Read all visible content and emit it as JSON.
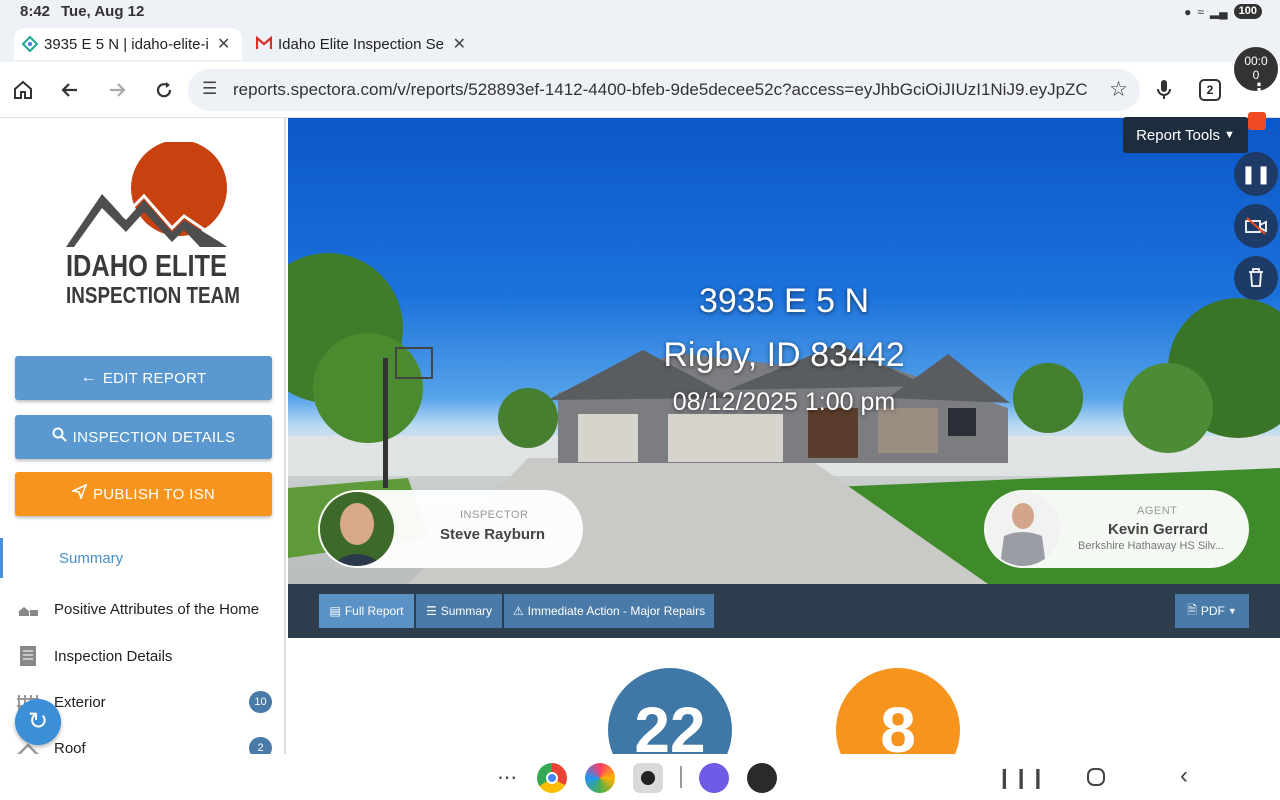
{
  "status_bar": {
    "time": "8:42",
    "date": "Tue, Aug 12",
    "battery": "100"
  },
  "tabs": [
    {
      "title": "3935 E 5 N | idaho-elite-i",
      "active": true
    },
    {
      "title": "Idaho Elite Inspection Se",
      "active": false
    }
  ],
  "toolbar": {
    "url": "reports.spectora.com/v/reports/528893ef-1412-4400-bfeb-9de5decee52c?access=eyJhbGciOiJIUzI1NiJ9.eyJpZC",
    "tab_count": "2"
  },
  "sidebar": {
    "logo_line1": "IDAHO ELITE",
    "logo_line2": "INSPECTION TEAM",
    "buttons": {
      "edit": "EDIT REPORT",
      "details": "INSPECTION DETAILS",
      "publish": "PUBLISH TO ISN"
    },
    "nav": [
      {
        "label": "Summary",
        "badge": ""
      },
      {
        "label": "Positive Attributes of the Home",
        "badge": ""
      },
      {
        "label": "Inspection Details",
        "badge": ""
      },
      {
        "label": "Exterior",
        "badge": "10"
      },
      {
        "label": "Roof",
        "badge": "2"
      }
    ]
  },
  "hero": {
    "address_line1": "3935 E 5 N",
    "address_line2": "Rigby, ID 83442",
    "datetime": "08/12/2025 1:00 pm",
    "inspector": {
      "role": "INSPECTOR",
      "name": "Steve Rayburn"
    },
    "agent": {
      "role": "AGENT",
      "name": "Kevin Gerrard",
      "company": "Berkshire Hathaway HS Silv..."
    }
  },
  "recorder": {
    "timer_line1": "00:0",
    "timer_line2": "0"
  },
  "report_tools": {
    "label": "Report Tools"
  },
  "report_nav": {
    "tabs": [
      "Full Report",
      "Summary",
      "Immediate Action - Major Repairs"
    ],
    "pdf": "PDF"
  },
  "counters": [
    {
      "value": "22",
      "color": "#3f78a6"
    },
    {
      "value": "8",
      "color": "#f7941d"
    }
  ],
  "colors": {
    "blue_button": "#5a98cf",
    "orange_button": "#f7941d",
    "nav_bar": "#2e3e4e"
  }
}
